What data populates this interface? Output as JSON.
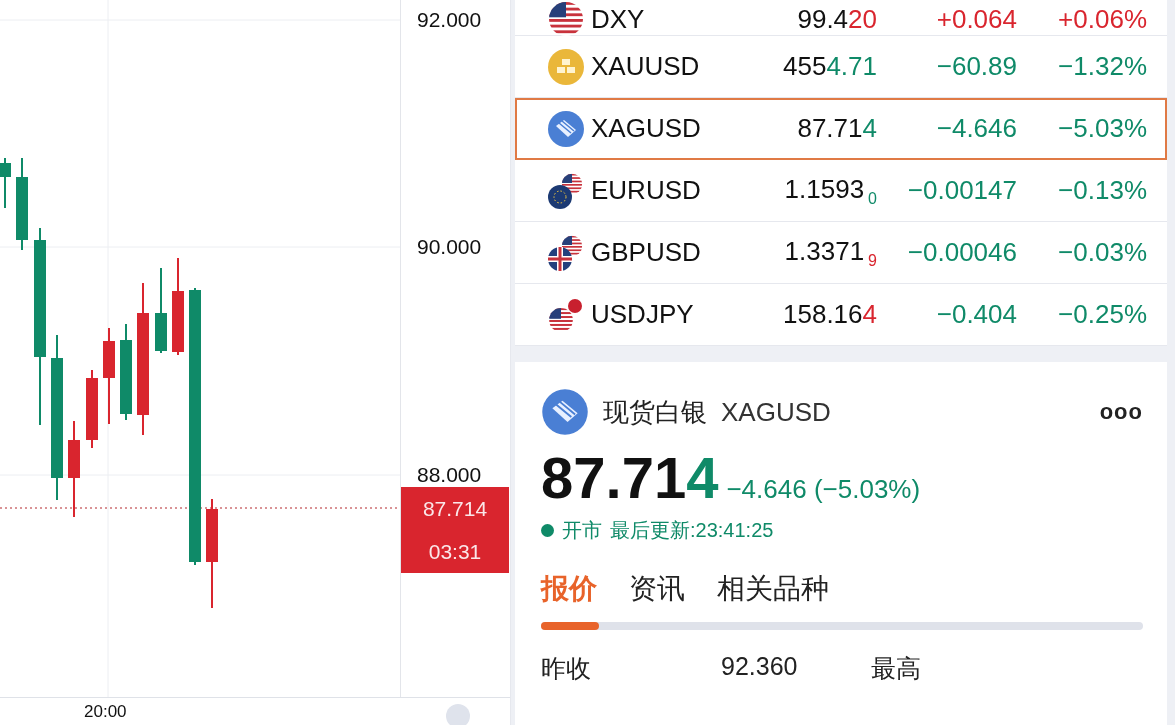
{
  "chart": {
    "price_axis": [
      "92.000",
      "90.000",
      "88.000"
    ],
    "last_price": "87.714",
    "countdown": "03:31",
    "time_axis": [
      "20:00"
    ]
  },
  "quotes": [
    {
      "kind": "usd",
      "symbol": "DXY",
      "price_main": "99.4",
      "price_tail": "20",
      "tail_small": false,
      "tail_up": true,
      "change": "+0.064",
      "percent": "+0.06%",
      "up": true,
      "selected": false
    },
    {
      "kind": "gold",
      "symbol": "XAUUSD",
      "price_main": "455",
      "price_tail": "4.71",
      "tail_small": false,
      "tail_up": false,
      "change": "−60.89",
      "percent": "−1.32%",
      "up": false,
      "selected": false
    },
    {
      "kind": "silver",
      "symbol": "XAGUSD",
      "price_main": "87.71",
      "price_tail": "4",
      "tail_small": false,
      "tail_up": false,
      "change": "−4.646",
      "percent": "−5.03%",
      "up": false,
      "selected": true
    },
    {
      "kind": "eur",
      "symbol": "EURUSD",
      "price_main": "1.1593",
      "price_tail": "0",
      "tail_small": true,
      "tail_up": false,
      "change": "−0.00147",
      "percent": "−0.13%",
      "up": false,
      "selected": false
    },
    {
      "kind": "gbp",
      "symbol": "GBPUSD",
      "price_main": "1.3371",
      "price_tail": "9",
      "tail_small": true,
      "tail_up": true,
      "change": "−0.00046",
      "percent": "−0.03%",
      "up": false,
      "selected": false
    },
    {
      "kind": "jpy",
      "symbol": "USDJPY",
      "price_main": "158.16",
      "price_tail": "4",
      "tail_small": false,
      "tail_up": true,
      "change": "−0.404",
      "percent": "−0.25%",
      "up": false,
      "selected": false
    }
  ],
  "detail": {
    "name": "现货白银",
    "symbol": "XAGUSD",
    "more": "ooo",
    "price_main": "87.71",
    "price_tail": "4",
    "up": false,
    "change": "−4.646 (−5.03%)",
    "market_open": true,
    "status": "开市",
    "updated": "最后更新:23:41:25",
    "tabs": [
      {
        "label": "报价",
        "selected": true
      },
      {
        "label": "资讯",
        "selected": false
      },
      {
        "label": "相关品种",
        "selected": false
      }
    ],
    "stats": [
      {
        "label": "昨收",
        "value": "92.360"
      },
      {
        "label": "最高"
      }
    ]
  }
}
